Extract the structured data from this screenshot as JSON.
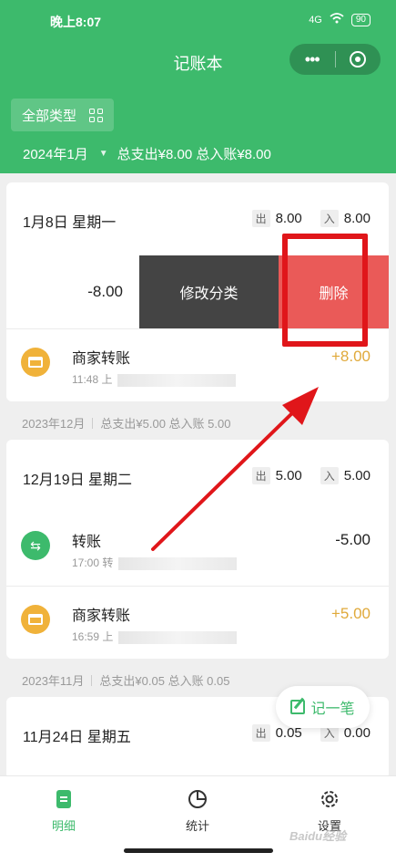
{
  "status": {
    "time": "晚上8:07",
    "battery": "90",
    "signal": "4G"
  },
  "header": {
    "title": "记账本",
    "filter_label": "全部类型",
    "month": "2024年1月",
    "month_summary": "总支出¥8.00  总入账¥8.00"
  },
  "groups": [
    {
      "day": "1月8日 星期一",
      "out_tag": "出",
      "out": "8.00",
      "in_tag": "入",
      "in": "8.00",
      "swipe": {
        "amount": "-8.00",
        "edit_label": "修改分类",
        "delete_label": "删除"
      },
      "rows": [
        {
          "icon": "shop-icon",
          "title": "商家转账",
          "time": "11:48",
          "note": "上",
          "amount": "+8.00"
        }
      ]
    }
  ],
  "section_dec": {
    "month": "2023年12月",
    "summary": "总支出¥5.00  总入账 5.00"
  },
  "group_dec": {
    "day": "12月19日 星期二",
    "out_tag": "出",
    "out": "5.00",
    "in_tag": "入",
    "in": "5.00",
    "rows": [
      {
        "icon": "transfer-icon",
        "title": "转账",
        "time": "17:00",
        "note": "转",
        "amount": "-5.00"
      },
      {
        "icon": "shop-icon",
        "title": "商家转账",
        "time": "16:59",
        "note": "上",
        "amount": "+5.00"
      }
    ]
  },
  "section_nov": {
    "month": "2023年11月",
    "summary": "总支出¥0.05  总入账 0.05"
  },
  "group_nov": {
    "day": "11月24日 星期五",
    "out_tag": "出",
    "out": "0.05",
    "in_tag": "入",
    "in": "0.00"
  },
  "fab": {
    "label": "记一笔"
  },
  "tabs": [
    {
      "label": "明细"
    },
    {
      "label": "统计"
    },
    {
      "label": "设置"
    }
  ],
  "watermark": "Baidu经验",
  "colors": {
    "primary": "#3dba6c",
    "income": "#e0a93a",
    "delete": "#ea5a58",
    "edit": "#444444",
    "annotation": "#e0161a"
  }
}
